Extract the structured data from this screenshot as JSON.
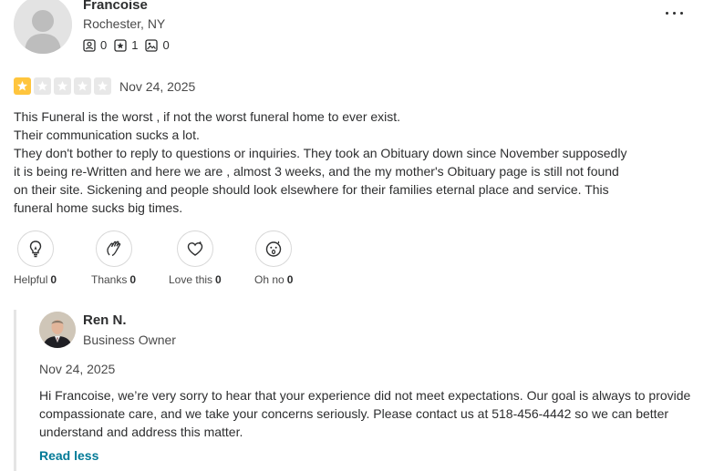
{
  "reviewer": {
    "name": "Francoise",
    "location": "Rochester, NY",
    "stats": [
      {
        "icon": "friends-icon",
        "count": "0"
      },
      {
        "icon": "reviews-star-icon",
        "count": "1"
      },
      {
        "icon": "photos-icon",
        "count": "0"
      }
    ]
  },
  "review": {
    "rating": 1,
    "max_rating": 5,
    "date": "Nov 24, 2025",
    "lines": [
      "This Funeral is the worst , if not the worst funeral home to ever exist.",
      "Their communication sucks a lot.",
      "They don't bother to reply to questions or inquiries. They took an Obituary down since November supposedly it is being re-Written and here we are , almost 3 weeks, and the my mother's Obituary page is still not found on their site. Sickening and people should look elsewhere for their families eternal place and service. This funeral home sucks big times."
    ]
  },
  "reactions": [
    {
      "label": "Helpful",
      "count": "0",
      "icon": "lightbulb-icon"
    },
    {
      "label": "Thanks",
      "count": "0",
      "icon": "hands-icon"
    },
    {
      "label": "Love this",
      "count": "0",
      "icon": "heart-icon"
    },
    {
      "label": "Oh no",
      "count": "0",
      "icon": "shocked-face-icon"
    }
  ],
  "owner_reply": {
    "name": "Ren N.",
    "role": "Business Owner",
    "date": "Nov 24, 2025",
    "text": "Hi Francoise, we’re very sorry to hear that your experience did not meet expectations. Our goal is always to provide compassionate care, and we take your concerns seriously. Please contact us at 518-456-4442 so we can better understand and address this matter.",
    "toggle_label": "Read less"
  },
  "colors": {
    "star_filled": "#ffc53d",
    "star_empty": "#e8e8e8",
    "link": "#027a97"
  }
}
